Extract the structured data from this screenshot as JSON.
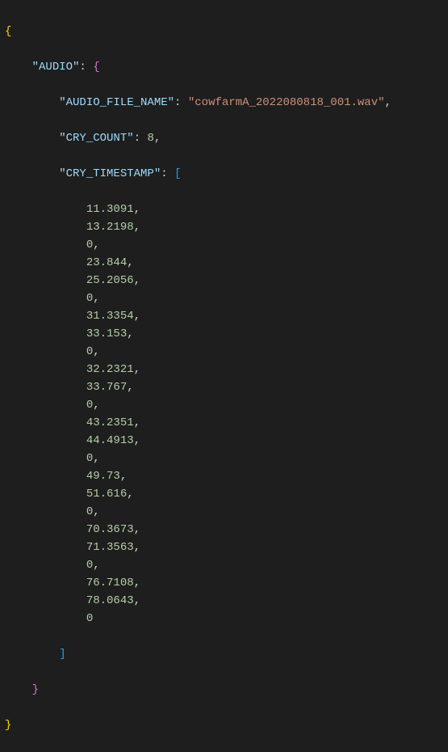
{
  "json": {
    "top_open": "{",
    "top_close": "}",
    "audio_key": "\"AUDIO\"",
    "audio_open": "{",
    "audio_close": "}",
    "file_key": "\"AUDIO_FILE_NAME\"",
    "file_value": "\"cowfarmA_2022080818_001.wav\"",
    "count_key": "\"CRY_COUNT\"",
    "count_value": "8",
    "ts_key": "\"CRY_TIMESTAMP\"",
    "ts_open": "[",
    "ts_close": "]",
    "ts_values": [
      "11.3091",
      "13.2198",
      "0",
      "23.844",
      "25.2056",
      "0",
      "31.3354",
      "33.153",
      "0",
      "32.2321",
      "33.767",
      "0",
      "43.2351",
      "44.4913",
      "0",
      "49.73",
      "51.616",
      "0",
      "70.3673",
      "71.3563",
      "0",
      "76.7108",
      "78.0643",
      "0"
    ]
  },
  "indent": {
    "l1": "    ",
    "l2": "        ",
    "l3": "            "
  },
  "chart_data": {
    "type": "table",
    "title": "AUDIO JSON record",
    "fields": {
      "AUDIO_FILE_NAME": "cowfarmA_2022080818_001.wav",
      "CRY_COUNT": 8,
      "CRY_TIMESTAMP": [
        11.3091,
        13.2198,
        0,
        23.844,
        25.2056,
        0,
        31.3354,
        33.153,
        0,
        32.2321,
        33.767,
        0,
        43.2351,
        44.4913,
        0,
        49.73,
        51.616,
        0,
        70.3673,
        71.3563,
        0,
        76.7108,
        78.0643,
        0
      ]
    }
  }
}
